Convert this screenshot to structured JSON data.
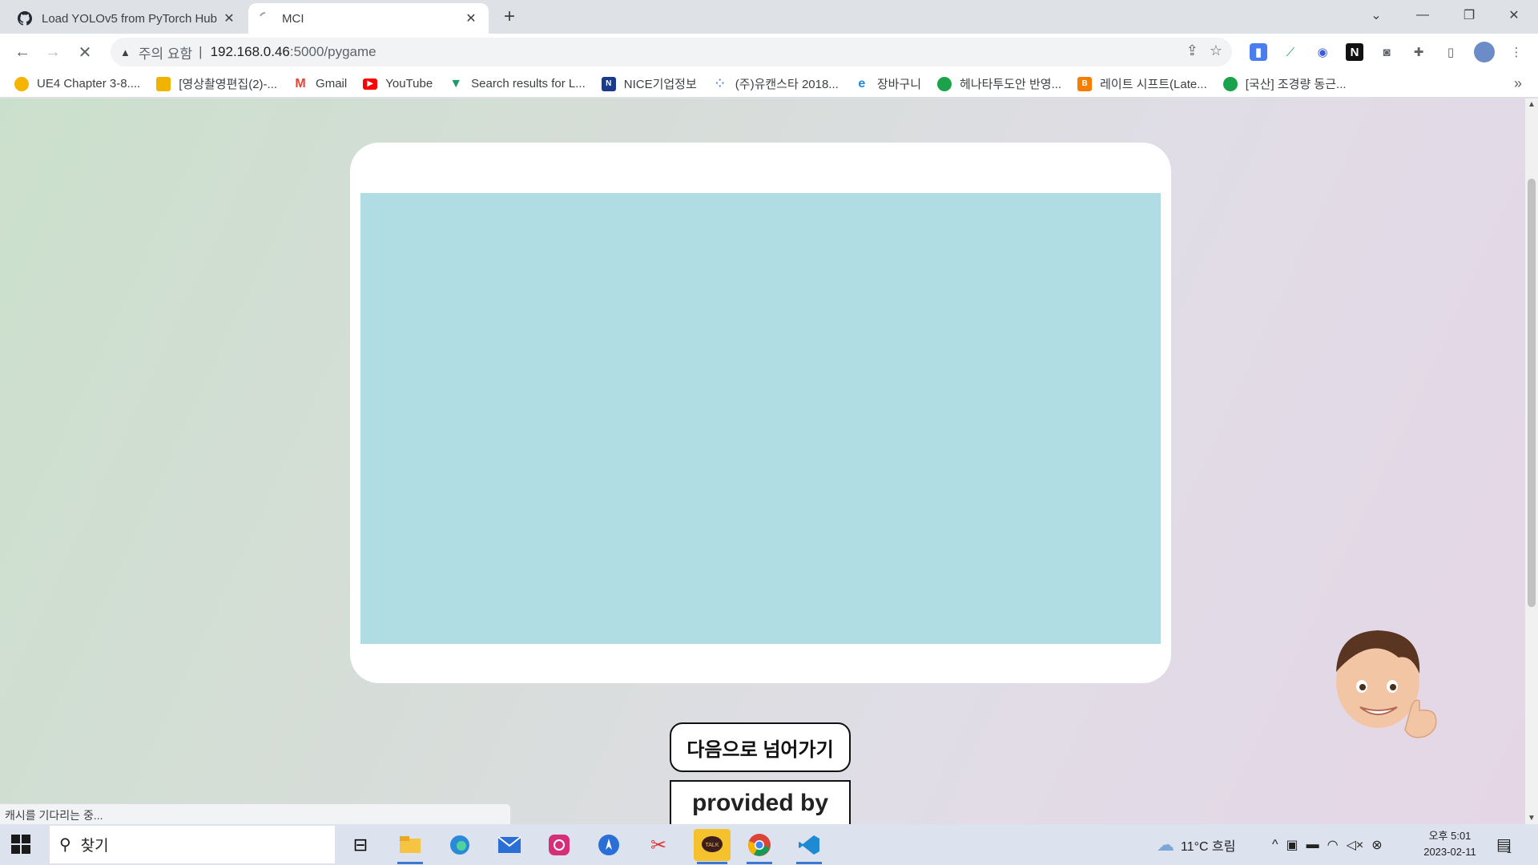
{
  "browser": {
    "tabs": [
      {
        "title": "Load YOLOv5 from PyTorch Hub",
        "icon": "github-icon",
        "active": false
      },
      {
        "title": "MCI",
        "icon": "loading-spinner-icon",
        "active": true
      }
    ],
    "new_tab": "+",
    "address": {
      "security_label": "주의 요함",
      "separator": "|",
      "host": "192.168.0.46",
      "path": ":5000/pygame"
    },
    "bookmarks": [
      {
        "label": "UE4 Chapter 3-8....",
        "icon": "moon-icon",
        "color": "#f5b400"
      },
      {
        "label": "[영상촬영편집(2)-...",
        "icon": "classroom-icon",
        "color": "#f0b400"
      },
      {
        "label": "Gmail",
        "icon": "gmail-icon",
        "color": "#ea4335"
      },
      {
        "label": "YouTube",
        "icon": "youtube-icon",
        "color": "#ff0000"
      },
      {
        "label": "Search results for L...",
        "icon": "vuetify-icon",
        "color": "#1e9a6e"
      },
      {
        "label": "NICE기업정보",
        "icon": "nice-icon",
        "color": "#1a3a8a"
      },
      {
        "label": "(주)유캔스타 2018...",
        "icon": "dots-icon",
        "color": "#6a8fd0"
      },
      {
        "label": "장바구니",
        "icon": "ie-icon",
        "color": "#1f8ad8"
      },
      {
        "label": "헤나타투도안 반영...",
        "icon": "shield-green-icon",
        "color": "#1aa34a"
      },
      {
        "label": "레이트 시프트(Late...",
        "icon": "blogger-icon",
        "color": "#f57d00"
      },
      {
        "label": "[국산] 조경량 동근...",
        "icon": "shield-green-icon",
        "color": "#1aa34a"
      }
    ],
    "bookmarks_more": "»",
    "status_text": "캐시를 기다리는 중..."
  },
  "page": {
    "next_button_label": "다음으로 넘어가기",
    "credit_label": "provided by",
    "game_area_color": "#b0dde4",
    "avatar": "memoji-thumbs-up-icon"
  },
  "taskbar": {
    "search_placeholder": "찾기",
    "weather": "11°C  흐림",
    "time": "오후 5:01",
    "date": "2023-02-11",
    "notification_count": "1"
  }
}
